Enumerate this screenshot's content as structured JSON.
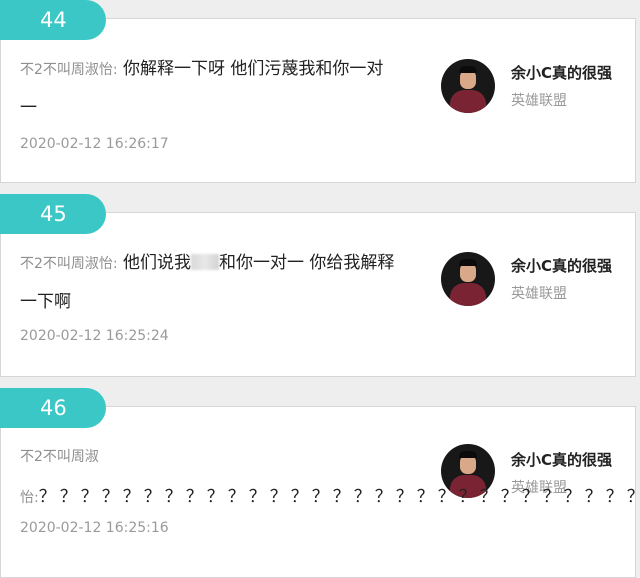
{
  "comments": [
    {
      "number": "44",
      "sender": "不2不叫周淑怡:",
      "text": "你解释一下呀 他们污蔑我和你一对一",
      "time": "2020-02-12 16:26:17",
      "streamer": "余小C真的很强",
      "game": "英雄联盟"
    },
    {
      "number": "45",
      "sender": "不2不叫周淑怡:",
      "text_before": "他们说我",
      "text_after": "和你一对一 你给我解释一下啊",
      "time": "2020-02-12 16:25:24",
      "streamer": "余小C真的很强",
      "game": "英雄联盟"
    },
    {
      "number": "46",
      "sender_line1": "不2不叫周淑",
      "sender_line2": "怡:",
      "text": "？？？？？？？？？？？？？？？？？？？？？？？？？？？？？？",
      "time": "2020-02-12 16:25:16",
      "streamer": "余小C真的很强",
      "game": "英雄联盟"
    }
  ],
  "colors": {
    "tab": "#3cc7c7",
    "background": "#eeeeee"
  },
  "icons": {
    "avatar": "streamer-avatar"
  }
}
